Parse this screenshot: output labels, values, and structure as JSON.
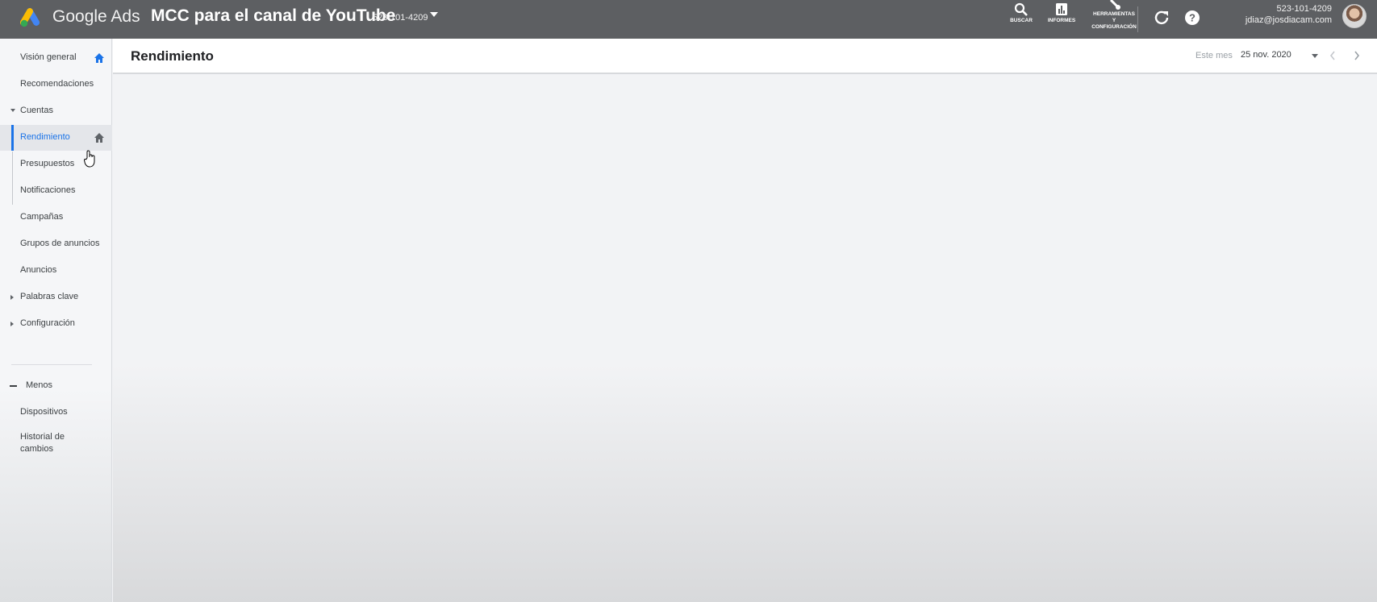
{
  "topbar": {
    "brand": "Google Ads",
    "account_name": "MCC para el canal de YouTube",
    "account_id": "523-101-4209",
    "tools": {
      "search_label": "BUSCAR",
      "reports_label": "INFORMES",
      "tools_label_1": "HERRAMIENTAS",
      "tools_label_2": "Y",
      "tools_label_3": "CONFIGURACIÓN"
    },
    "user_id": "523-101-4209",
    "user_email": "jdiaz@josdiacam.com",
    "colors": {
      "bar": "#5d5f62",
      "logo_blue": "#4285f4",
      "logo_yellow": "#fbbc04",
      "logo_green": "#34a853"
    }
  },
  "sidebar": {
    "items": [
      {
        "label": "Visión general",
        "icon": "home-icon"
      },
      {
        "label": "Recomendaciones"
      },
      {
        "label": "Cuentas",
        "expander": "expanded"
      },
      {
        "label": "Rendimiento",
        "active": true,
        "icon": "home-icon"
      },
      {
        "label": "Presupuestos"
      },
      {
        "label": "Notificaciones"
      },
      {
        "label": "Campañas"
      },
      {
        "label": "Grupos de anuncios"
      },
      {
        "label": "Anuncios"
      },
      {
        "label": "Palabras clave",
        "expander": "collapsed"
      },
      {
        "label": "Configuración",
        "expander": "collapsed"
      }
    ],
    "less_label": "Menos",
    "extra_items": [
      {
        "label": "Dispositivos"
      },
      {
        "label": "Historial de cambios",
        "line1": "Historial de",
        "line2": "cambios"
      }
    ],
    "accent_color": "#1a73e8"
  },
  "header": {
    "title": "Rendimiento",
    "date_range_label": "Este mes",
    "date_value": "25 nov. 2020"
  }
}
